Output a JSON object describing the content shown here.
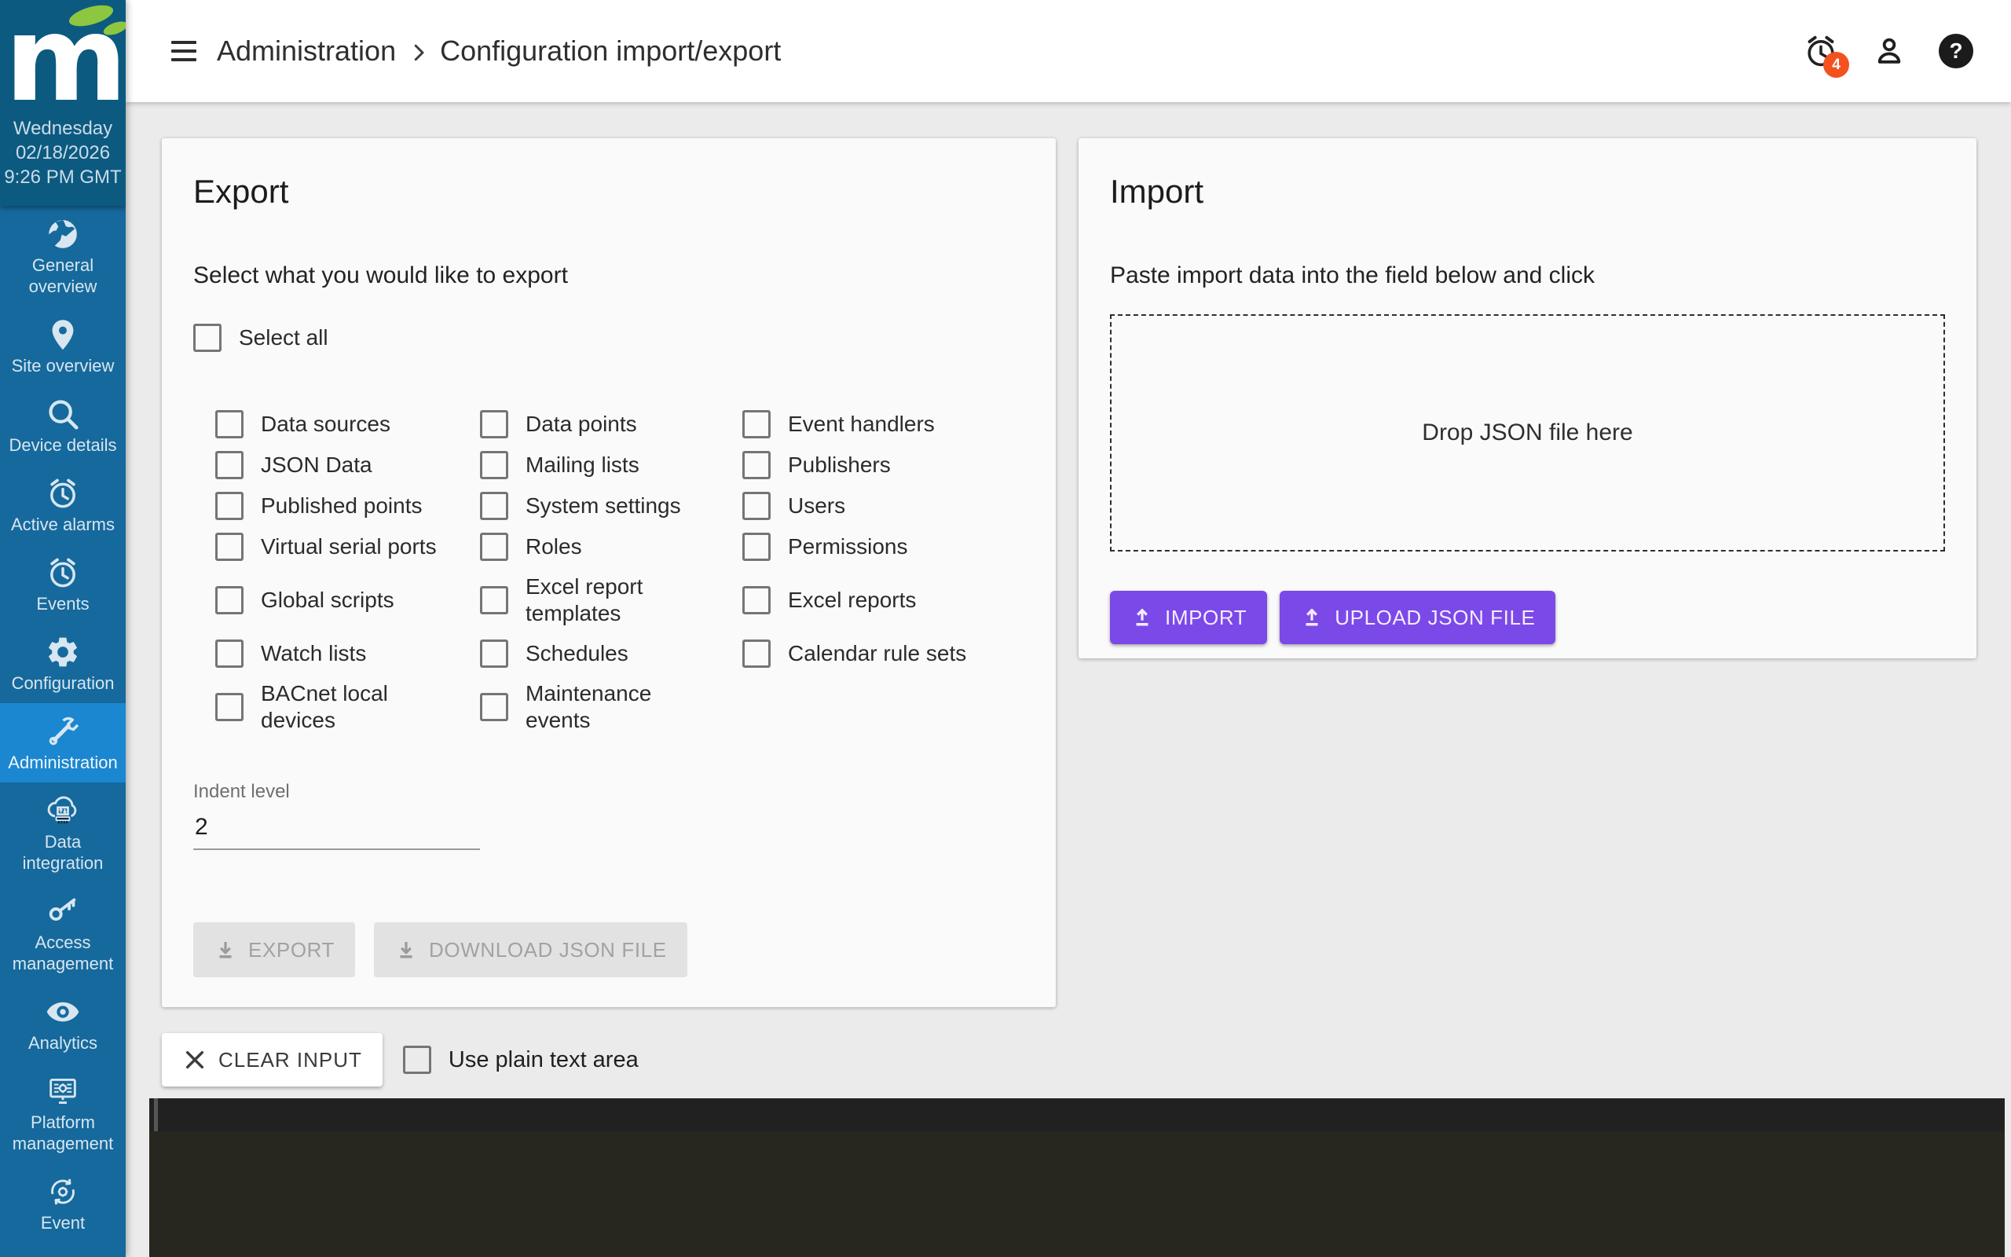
{
  "sidebar": {
    "logo_letter": "m",
    "datetime": {
      "weekday": "Wednesday",
      "date": "02/18/2026",
      "time": "9:26 PM GMT"
    },
    "items": [
      {
        "label": "General overview",
        "icon": "globe-icon",
        "active": false
      },
      {
        "label": "Site overview",
        "icon": "map-pin-icon",
        "active": false
      },
      {
        "label": "Device details",
        "icon": "search-icon",
        "active": false
      },
      {
        "label": "Active alarms",
        "icon": "alarm-clock-icon",
        "active": false
      },
      {
        "label": "Events",
        "icon": "alarm-clock-icon",
        "active": false
      },
      {
        "label": "Configuration",
        "icon": "gear-icon",
        "active": false
      },
      {
        "label": "Administration",
        "icon": "wrench-icon",
        "active": true
      },
      {
        "label": "Data integration",
        "icon": "cloud-sync-icon",
        "active": false
      },
      {
        "label": "Access management",
        "icon": "key-icon",
        "active": false
      },
      {
        "label": "Analytics",
        "icon": "eye-icon",
        "active": false
      },
      {
        "label": "Platform management",
        "icon": "monitor-gear-icon",
        "active": false
      },
      {
        "label": "Event",
        "icon": "gear-cycle-icon",
        "active": false
      }
    ]
  },
  "header": {
    "breadcrumb_section": "Administration",
    "breadcrumb_page": "Configuration import/export",
    "alarm_count": "4"
  },
  "export_card": {
    "title": "Export",
    "subtitle": "Select what you would like to export",
    "select_all_label": "Select all",
    "options": [
      "Data sources",
      "Data points",
      "Event handlers",
      "JSON Data",
      "Mailing lists",
      "Publishers",
      "Published points",
      "System settings",
      "Users",
      "Virtual serial ports",
      "Roles",
      "Permissions",
      "Global scripts",
      "Excel report\ntemplates",
      "Excel reports",
      "Watch lists",
      "Schedules",
      "Calendar rule sets",
      "BACnet local\ndevices",
      "Maintenance\nevents"
    ],
    "indent_label": "Indent level",
    "indent_value": "2",
    "export_button_label": "EXPORT",
    "download_button_label": "DOWNLOAD JSON FILE"
  },
  "import_card": {
    "title": "Import",
    "subtitle": "Paste import data into the field below and click",
    "dropzone_text": "Drop JSON file here",
    "import_button_label": "IMPORT",
    "upload_button_label": "UPLOAD JSON FILE"
  },
  "footer": {
    "clear_button_label": "CLEAR INPUT",
    "plain_text_label": "Use plain text area"
  },
  "colors": {
    "sidebar_top": "#0d5a80",
    "sidebar_nav": "#16699c",
    "sidebar_active": "#1b87d0",
    "leaf_green": "#8dc63f",
    "accent_purple": "#7b49e8",
    "badge_orange": "#f4511e",
    "disabled_button": "#e2e2e2",
    "page_background": "#ebebeb",
    "card_background": "#fafafa",
    "editor_gutter_band": "#212121",
    "editor_body": "#27271f"
  }
}
